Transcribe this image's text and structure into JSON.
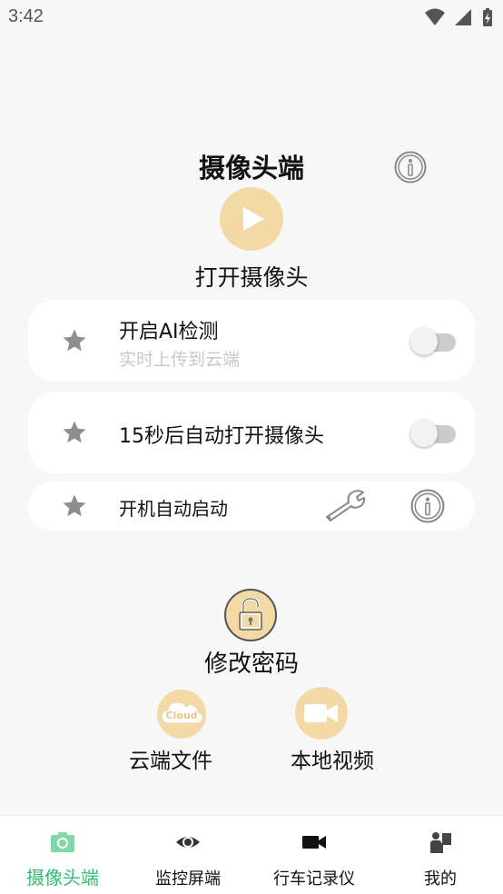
{
  "status_bar": {
    "time": "3:42"
  },
  "header": {
    "title": "摄像头端"
  },
  "camera": {
    "open_label": "打开摄像头"
  },
  "settings": {
    "ai_detect": {
      "title": "开启AI检测",
      "subtitle": "实时上传到云端",
      "enabled": false
    },
    "auto_open": {
      "title": "15秒后自动打开摄像头",
      "enabled": false
    },
    "boot_start": {
      "title": "开机自动启动"
    }
  },
  "actions": {
    "change_password": "修改密码",
    "cloud_files": "云端文件",
    "cloud_icon_text": "Cloud",
    "local_video": "本地视频"
  },
  "bottom_nav": [
    {
      "label": "摄像头端",
      "active": true
    },
    {
      "label": "监控屏端",
      "active": false
    },
    {
      "label": "行车记录仪",
      "active": false
    },
    {
      "label": "我的",
      "active": false
    }
  ],
  "colors": {
    "accent": "#2fbf72",
    "icon_bg": "#f3d9a6",
    "card_bg": "#ffffff",
    "page_bg": "#f7f7f7"
  }
}
